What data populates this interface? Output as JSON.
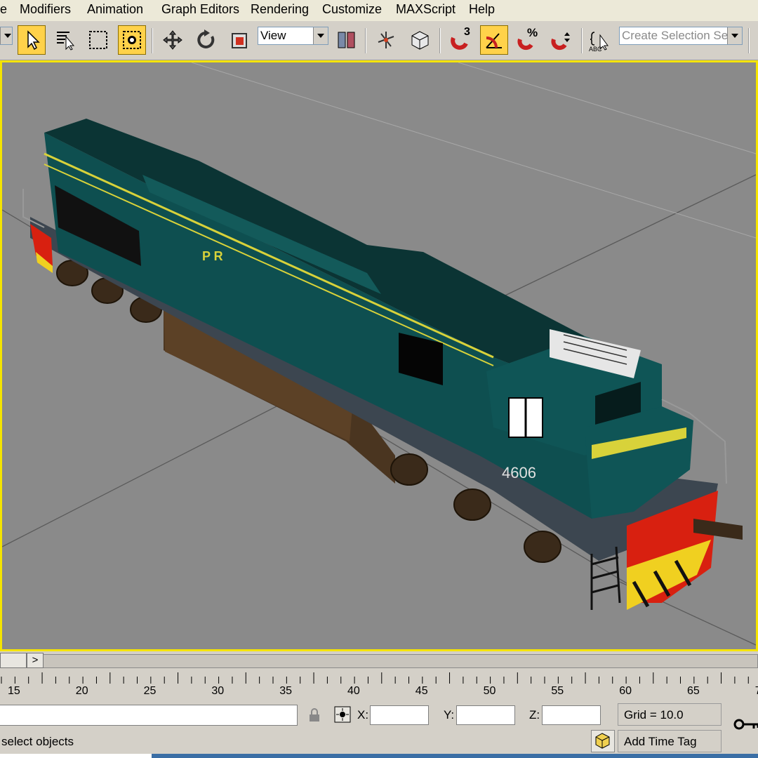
{
  "menu": {
    "file_partial": "e",
    "modifiers": "Modifiers",
    "animation": "Animation",
    "graph_editors": "Graph Editors",
    "rendering": "Rendering",
    "customize": "Customize",
    "maxscript": "MAXScript",
    "help": "Help"
  },
  "toolbar": {
    "reference_coord": "View",
    "named_selection_placeholder": "Create Selection Set",
    "angle_snap_label": "3",
    "percent_snap_label": "%",
    "edit_named_label": "ABC"
  },
  "viewport": {
    "locomotive_logo": "P R",
    "locomotive_number": "4606"
  },
  "timeline": {
    "ticks": [
      "15",
      "20",
      "25",
      "30",
      "35",
      "40",
      "45",
      "50",
      "55",
      "60",
      "65",
      "7"
    ]
  },
  "status": {
    "x_label": "X:",
    "y_label": "Y:",
    "z_label": "Z:",
    "grid": "Grid = 10.0",
    "prompt": "select objects",
    "add_time_tag": "Add Time Tag"
  },
  "colors": {
    "viewport_border": "#f5e400",
    "active_button": "#ffd24a",
    "loco_body": "#0c4a4a",
    "loco_stripe": "#d8d23a"
  }
}
